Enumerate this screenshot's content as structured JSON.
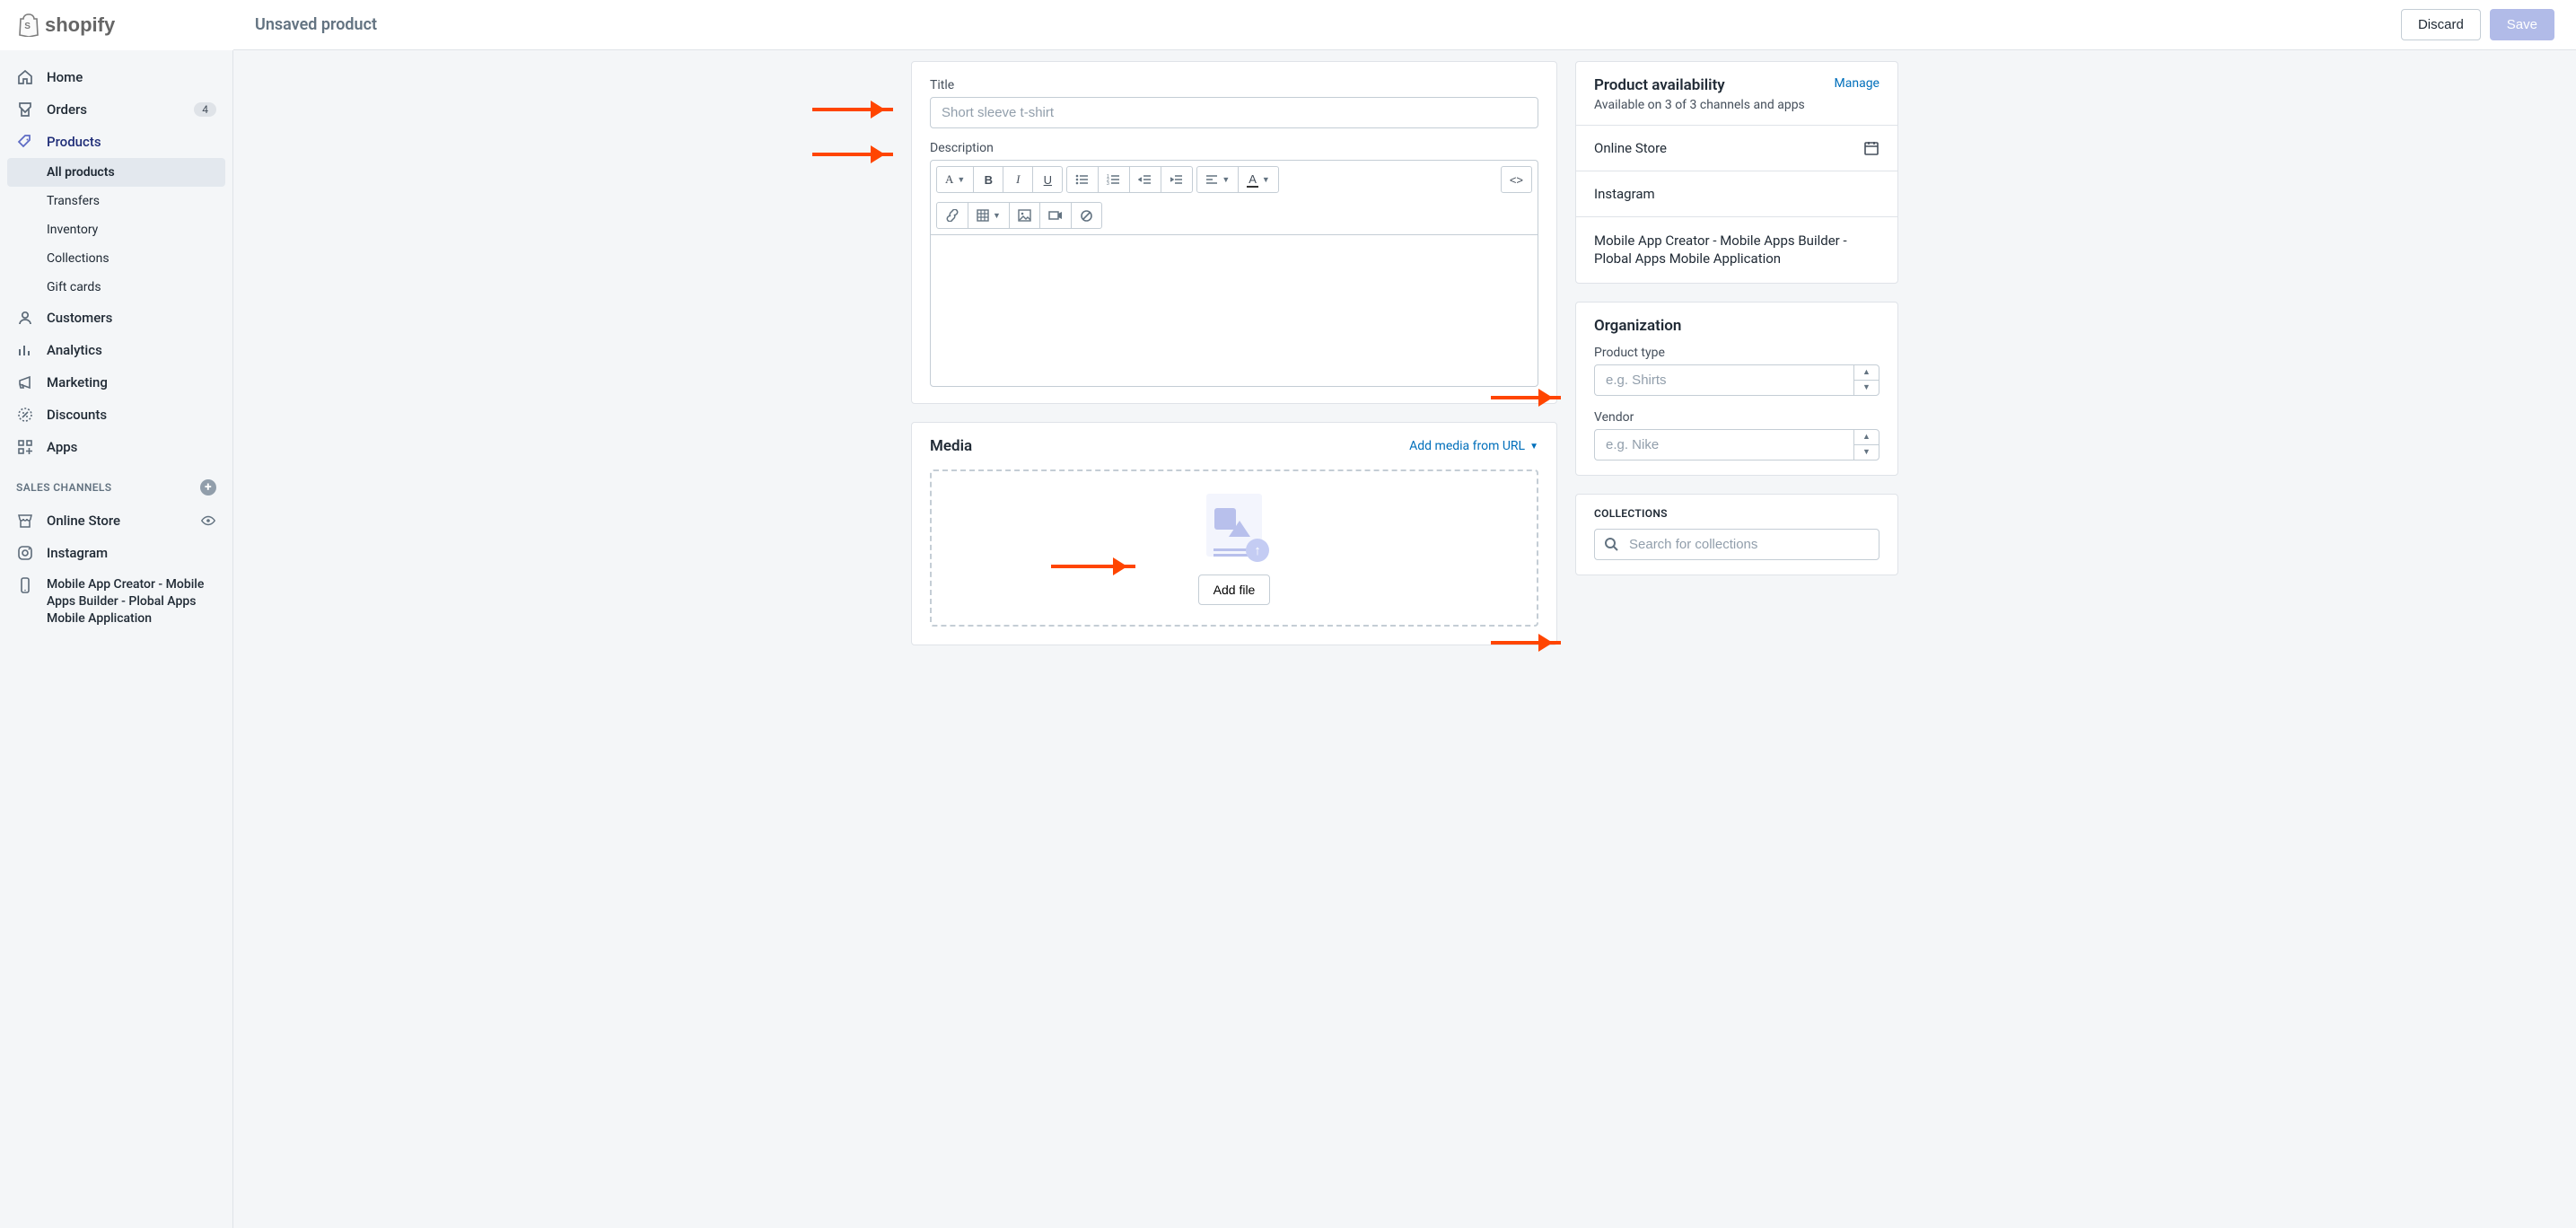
{
  "brand": "shopify",
  "pagebar": {
    "title": "Unsaved product",
    "discard": "Discard",
    "save": "Save"
  },
  "nav": {
    "home": "Home",
    "orders": "Orders",
    "orders_badge": "4",
    "products": "Products",
    "all_products": "All products",
    "transfers": "Transfers",
    "inventory": "Inventory",
    "collections": "Collections",
    "gift_cards": "Gift cards",
    "customers": "Customers",
    "analytics": "Analytics",
    "marketing": "Marketing",
    "discounts": "Discounts",
    "apps": "Apps",
    "sales_channels_title": "SALES CHANNELS",
    "online_store": "Online Store",
    "instagram": "Instagram",
    "mobile_app": "Mobile App Creator - Mobile Apps Builder - Plobal Apps Mobile Application"
  },
  "product_form": {
    "title_label": "Title",
    "title_placeholder": "Short sleeve t-shirt",
    "description_label": "Description",
    "media_title": "Media",
    "add_media_link": "Add media from URL",
    "add_file_btn": "Add file"
  },
  "availability": {
    "title": "Product availability",
    "manage": "Manage",
    "subtitle": "Available on 3 of 3 channels and apps",
    "row_online_store": "Online Store",
    "row_instagram": "Instagram",
    "row_mobile": "Mobile App Creator - Mobile Apps Builder - Plobal Apps Mobile Application"
  },
  "organization": {
    "title": "Organization",
    "product_type_label": "Product type",
    "product_type_placeholder": "e.g. Shirts",
    "vendor_label": "Vendor",
    "vendor_placeholder": "e.g. Nike",
    "collections_title": "COLLECTIONS",
    "collections_search_placeholder": "Search for collections"
  },
  "rte_toolbar": {
    "font": "A",
    "bold": "B",
    "italic": "I",
    "underline": "U",
    "color": "A",
    "code": "<>"
  }
}
